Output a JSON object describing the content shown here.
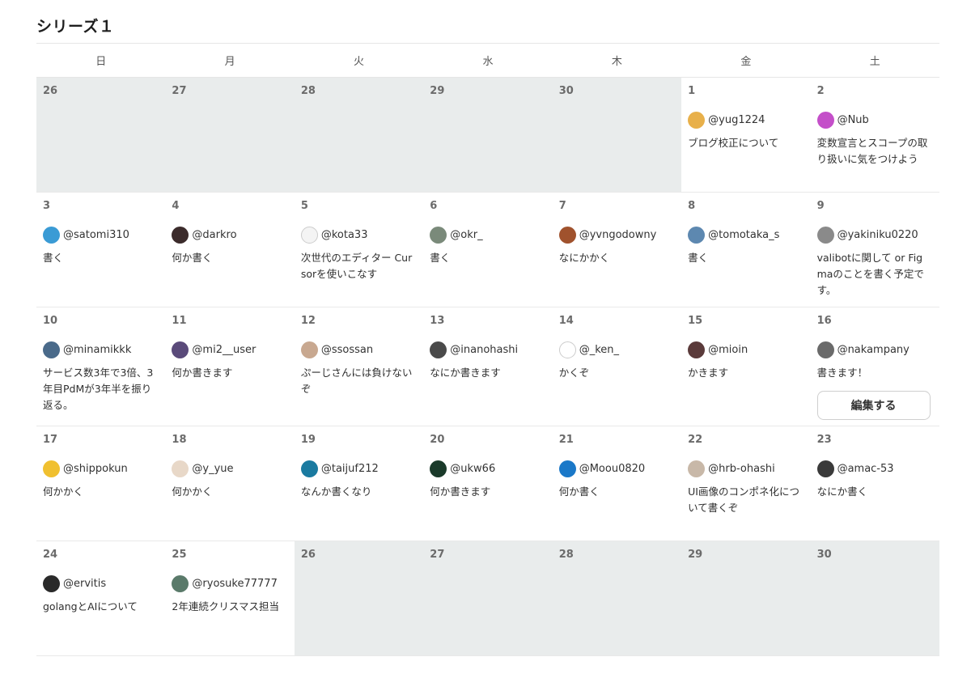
{
  "series_title": "シリーズ１",
  "weekdays": [
    "日",
    "月",
    "火",
    "水",
    "木",
    "金",
    "土"
  ],
  "edit_button": "編集する",
  "weeks": [
    [
      {
        "day": "26",
        "out": true
      },
      {
        "day": "27",
        "out": true
      },
      {
        "day": "28",
        "out": true
      },
      {
        "day": "29",
        "out": true
      },
      {
        "day": "30",
        "out": true
      },
      {
        "day": "1",
        "user": "@yug1224",
        "title": "ブログ校正について",
        "avatar_color": "#e8b04a"
      },
      {
        "day": "2",
        "user": "@Nub",
        "title": "変数宣言とスコープの取り扱いに気をつけよう",
        "avatar_color": "#c44fc9"
      }
    ],
    [
      {
        "day": "3",
        "user": "@satomi310",
        "title": "書く",
        "avatar_color": "#3a9bd5"
      },
      {
        "day": "4",
        "user": "@darkro",
        "title": "何か書く",
        "avatar_color": "#3b2b2b"
      },
      {
        "day": "5",
        "user": "@kota33",
        "title": "次世代のエディター Cursorを使いこなす",
        "avatar_color": "#f4f4f4"
      },
      {
        "day": "6",
        "user": "@okr_",
        "title": "書く",
        "avatar_color": "#7a8a7a"
      },
      {
        "day": "7",
        "user": "@yvngodowny",
        "title": "なにかかく",
        "avatar_color": "#a0522d"
      },
      {
        "day": "8",
        "user": "@tomotaka_s",
        "title": "書く",
        "avatar_color": "#5d88b0"
      },
      {
        "day": "9",
        "user": "@yakiniku0220",
        "title": "valibotに関して or Figmaのことを書く予定です。",
        "avatar_color": "#8a8a8a"
      }
    ],
    [
      {
        "day": "10",
        "user": "@minamikkk",
        "title": "サービス数3年で3倍、3年目PdMが3年半を振り返る。",
        "avatar_color": "#4a6a8a"
      },
      {
        "day": "11",
        "user": "@mi2__user",
        "title": "何か書きます",
        "avatar_color": "#5a4a7a"
      },
      {
        "day": "12",
        "user": "@ssossan",
        "title": "ぷーじさんには負けないぞ",
        "avatar_color": "#c8a890"
      },
      {
        "day": "13",
        "user": "@inanohashi",
        "title": "なにか書きます",
        "avatar_color": "#4a4a4a"
      },
      {
        "day": "14",
        "user": "@_ken_",
        "title": "かくぞ",
        "avatar_color": "#ffffff"
      },
      {
        "day": "15",
        "user": "@mioin",
        "title": "かきます",
        "avatar_color": "#5a3a3a"
      },
      {
        "day": "16",
        "user": "@nakampany",
        "title": "書きます！",
        "avatar_color": "#6a6a6a",
        "edit": true
      }
    ],
    [
      {
        "day": "17",
        "user": "@shippokun",
        "title": "何かかく",
        "avatar_color": "#f0c030"
      },
      {
        "day": "18",
        "user": "@y_yue",
        "title": "何かかく",
        "avatar_color": "#e8d8c8"
      },
      {
        "day": "19",
        "user": "@taijuf212",
        "title": "なんか書くなり",
        "avatar_color": "#1a7aa0"
      },
      {
        "day": "20",
        "user": "@ukw66",
        "title": "何か書きます",
        "avatar_color": "#1a3a2a"
      },
      {
        "day": "21",
        "user": "@Moou0820",
        "title": "何か書く",
        "avatar_color": "#1a78c8"
      },
      {
        "day": "22",
        "user": "@hrb-ohashi",
        "title": "UI画像のコンポネ化について書くぞ",
        "avatar_color": "#c8b8a8"
      },
      {
        "day": "23",
        "user": "@amac-53",
        "title": "なにか書く",
        "avatar_color": "#3a3a3a"
      }
    ],
    [
      {
        "day": "24",
        "user": "@ervitis",
        "title": "golangとAIについて",
        "avatar_color": "#2a2a2a"
      },
      {
        "day": "25",
        "user": "@ryosuke77777",
        "title": "2年連続クリスマス担当",
        "avatar_color": "#5a7a6a"
      },
      {
        "day": "26",
        "out": true
      },
      {
        "day": "27",
        "out": true
      },
      {
        "day": "28",
        "out": true
      },
      {
        "day": "29",
        "out": true
      },
      {
        "day": "30",
        "out": true
      }
    ]
  ]
}
